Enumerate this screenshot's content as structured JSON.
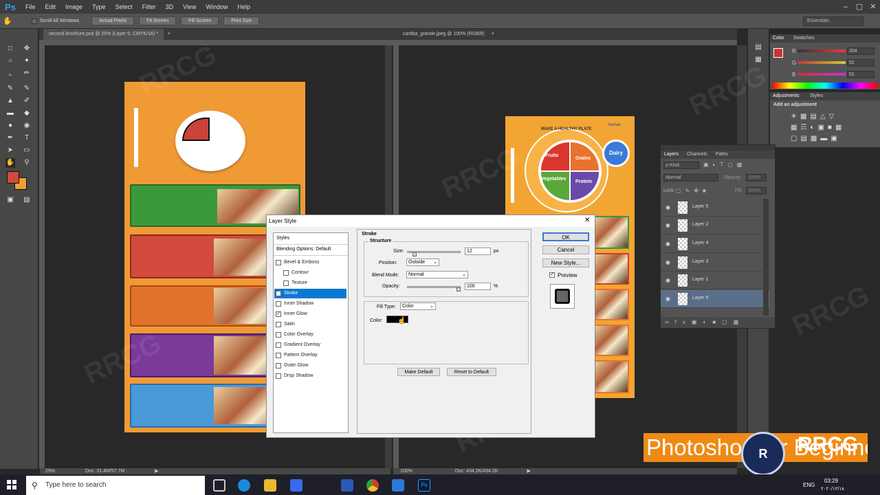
{
  "app": {
    "logo": "Ps",
    "menus": [
      "File",
      "Edit",
      "Image",
      "Type",
      "Select",
      "Filter",
      "3D",
      "View",
      "Window",
      "Help"
    ]
  },
  "options_bar": {
    "scroll_all_label": "Scroll All Windows",
    "buttons": [
      "Actual Pixels",
      "Fit Screen",
      "Fill Screen",
      "Print Size"
    ],
    "workspace": "Essentials"
  },
  "documents": [
    {
      "tab": "second brochure.psd @ 25% (Layer 9, CMYK/16) *",
      "zoom": "25%",
      "doc_info": "Doc: 31.4M/57.7M"
    },
    {
      "tab": "cardba_grande.jpeg @ 100% (RGB/8)",
      "zoom": "100%",
      "doc_info": "Doc: 434.2K/434.2K"
    }
  ],
  "plate": {
    "title": "MAKE A HEALTHY PLATE",
    "sections": [
      "Fruits",
      "Grains",
      "Vegetables",
      "Protein"
    ],
    "extra": "Dairy",
    "brand": "MyPlate"
  },
  "dialog": {
    "title": "Layer Style",
    "styles_header": "Styles",
    "blending": "Blending Options: Default",
    "styles": [
      {
        "label": "Bevel & Emboss",
        "checked": false,
        "indent": false
      },
      {
        "label": "Contour",
        "checked": false,
        "indent": true
      },
      {
        "label": "Texture",
        "checked": false,
        "indent": true
      },
      {
        "label": "Stroke",
        "checked": true,
        "indent": false,
        "selected": true
      },
      {
        "label": "Inner Shadow",
        "checked": false,
        "indent": false
      },
      {
        "label": "Inner Glow",
        "checked": true,
        "indent": false
      },
      {
        "label": "Satin",
        "checked": false,
        "indent": false
      },
      {
        "label": "Color Overlay",
        "checked": false,
        "indent": false
      },
      {
        "label": "Gradient Overlay",
        "checked": false,
        "indent": false
      },
      {
        "label": "Pattern Overlay",
        "checked": false,
        "indent": false
      },
      {
        "label": "Outer Glow",
        "checked": false,
        "indent": false
      },
      {
        "label": "Drop Shadow",
        "checked": false,
        "indent": false
      }
    ],
    "section_title": "Stroke",
    "structure": "Structure",
    "size_label": "Size:",
    "size_value": "12",
    "size_unit": "px",
    "position_label": "Position:",
    "position_value": "Outside",
    "blend_label": "Blend Mode:",
    "blend_value": "Normal",
    "opacity_label": "Opacity:",
    "opacity_value": "100",
    "opacity_unit": "%",
    "fill_type_label": "Fill Type:",
    "fill_type_value": "Color",
    "color_label": "Color:",
    "stroke_color": "#000000",
    "make_default": "Make Default",
    "reset_default": "Reset to Default",
    "ok": "OK",
    "cancel": "Cancel",
    "new_style": "New Style...",
    "preview": "Preview"
  },
  "color_panel": {
    "tabs": [
      "Color",
      "Swatches"
    ],
    "channels": [
      {
        "label": "R",
        "value": "204",
        "fraction": 0.8
      },
      {
        "label": "G",
        "value": "51",
        "fraction": 0.2
      },
      {
        "label": "B",
        "value": "51",
        "fraction": 0.2
      }
    ]
  },
  "adjustments": {
    "tabs": [
      "Adjustments",
      "Styles"
    ],
    "hint": "Add an adjustment"
  },
  "layers_panel": {
    "tabs": [
      "Layers",
      "Channels",
      "Paths"
    ],
    "kind": "ρ Kind",
    "mode": "Normal",
    "opacity_label": "Opacity:",
    "opacity_value": "100%",
    "lock_label": "Lock:",
    "fill_label": "Fill:",
    "fill_value": "100%",
    "layers": [
      "Layer 5",
      "Layer 2",
      "Layer 4",
      "Layer 3",
      "Layer 1",
      "Layer 9"
    ],
    "selected": "Layer 9"
  },
  "banner": {
    "text": "Photoshop for Beginners"
  },
  "taskbar": {
    "search_placeholder": "Type here to search",
    "lang": "ENG",
    "time": "03:29",
    "date": "٢٠٢٠/١٢/١٨"
  },
  "watermark": "RRCG"
}
